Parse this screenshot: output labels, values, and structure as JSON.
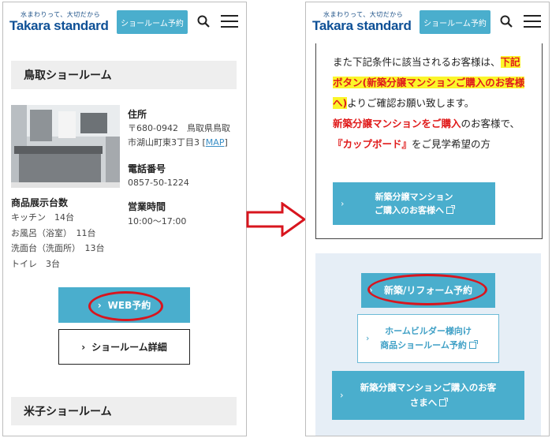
{
  "header": {
    "tagline": "水まわりって、大切だから",
    "brand": "Takara standard",
    "reserve_label": "ショールーム予約"
  },
  "left": {
    "section1_title": "鳥取ショールーム",
    "address_label": "住所",
    "address_line1": "〒680-0942　鳥取県鳥取",
    "address_line2": "市湖山町東3丁目3 [",
    "map_link": "MAP",
    "address_close": "]",
    "phone_label": "電話番号",
    "phone_value": "0857-50-1224",
    "hours_label": "営業時間",
    "hours_value": "10:00〜17:00",
    "display_label": "商品展示台数",
    "display_items": [
      "キッチン　14台",
      "お風呂（浴室）　11台",
      "洗面台（洗面所）　13台",
      "トイレ　3台"
    ],
    "web_button": "WEB予約",
    "detail_button": "ショールーム詳細",
    "section2_title": "米子ショールーム"
  },
  "right": {
    "notice_part1": "また下記条件に該当されるお客様は、",
    "notice_highlight": "下記ボタン(新築分譲マンションご購入のお客様へ)",
    "notice_part2": "よりご確認お願い致します。",
    "notice_red": "新築分譲マンションをご購入",
    "notice_part3": "のお客様で、",
    "notice_red2": "『カップボード』",
    "notice_part4": "をご見学希望の方",
    "condo_btn_line1": "新築分譲マンション",
    "condo_btn_line2": "ご購入のお客様へ",
    "newbuild_btn": "新築/リフォーム予約",
    "builder_btn_line1": "ホームビルダー様向け",
    "builder_btn_line2": "商品ショールーム予約",
    "condo_btn2_line1": "新築分譲マンションご購入のお客",
    "condo_btn2_line2": "さまへ"
  },
  "colors": {
    "accent": "#4aaecd",
    "brand": "#0e5096",
    "highlight_red": "#e01b1b",
    "highlight_yellow": "#fbf52a",
    "annotation_red": "#d8151e"
  }
}
